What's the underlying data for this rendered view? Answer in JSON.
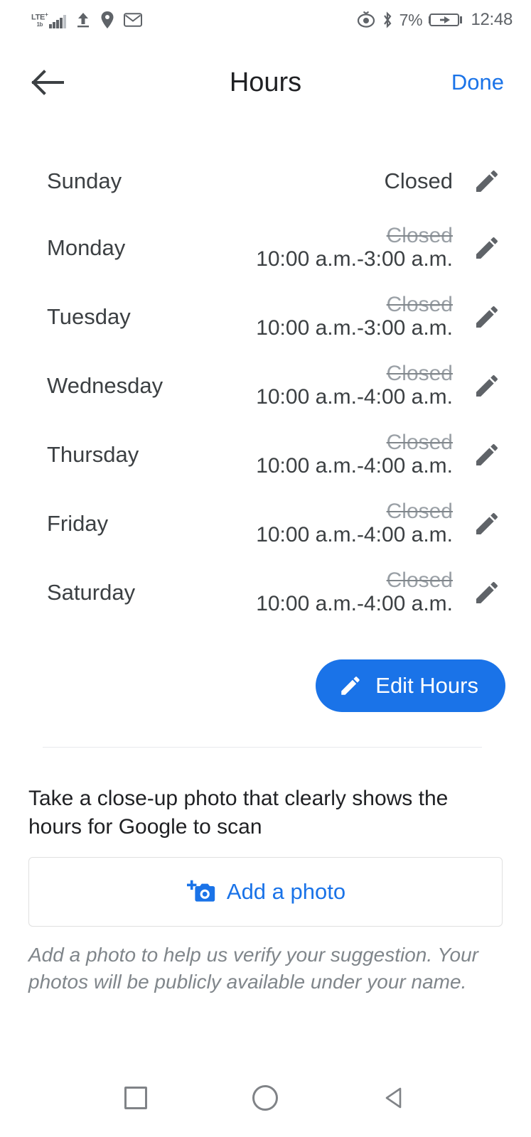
{
  "status_bar": {
    "network_label": "LTE",
    "network_sup": "+",
    "signal_sub": "1b",
    "icons": [
      "signal-bars-icon",
      "upload-icon",
      "location-pin-icon",
      "envelope-icon",
      "eye-care-icon",
      "bluetooth-icon"
    ],
    "battery_percent": "7%",
    "battery_state": "charging",
    "clock": "12:48"
  },
  "app_bar": {
    "back_label": "back-arrow",
    "title": "Hours",
    "done_label": "Done"
  },
  "hours": {
    "rows": [
      {
        "day": "Sunday",
        "old": "",
        "new": "",
        "single": "Closed",
        "edit_icon": "pencil-icon"
      },
      {
        "day": "Monday",
        "old": "Closed",
        "new": "10:00 a.m.-3:00 a.m.",
        "single": "",
        "edit_icon": "pencil-icon"
      },
      {
        "day": "Tuesday",
        "old": "Closed",
        "new": "10:00 a.m.-3:00 a.m.",
        "single": "",
        "edit_icon": "pencil-icon"
      },
      {
        "day": "Wednesday",
        "old": "Closed",
        "new": "10:00 a.m.-4:00 a.m.",
        "single": "",
        "edit_icon": "pencil-icon"
      },
      {
        "day": "Thursday",
        "old": "Closed",
        "new": "10:00 a.m.-4:00 a.m.",
        "single": "",
        "edit_icon": "pencil-icon"
      },
      {
        "day": "Friday",
        "old": "Closed",
        "new": "10:00 a.m.-4:00 a.m.",
        "single": "",
        "edit_icon": "pencil-icon"
      },
      {
        "day": "Saturday",
        "old": "Closed",
        "new": "10:00 a.m.-4:00 a.m.",
        "single": "",
        "edit_icon": "pencil-icon"
      }
    ],
    "edit_hours_label": "Edit Hours"
  },
  "photo_section": {
    "prompt": "Take a close-up photo that clearly shows the hours for Google to scan",
    "add_photo_label": "Add a photo",
    "disclaimer": "Add a photo to help us verify your suggestion. Your photos will be publicly available under your name."
  },
  "nav_bar": {
    "recents_label": "recents-square-icon",
    "home_label": "home-circle-icon",
    "back_label": "back-triangle-icon"
  },
  "colors": {
    "accent_blue": "#1a73e8",
    "text_primary": "#202124",
    "text_secondary": "#3c4043",
    "text_muted": "#9aa0a6",
    "divider": "#e8eaed"
  }
}
